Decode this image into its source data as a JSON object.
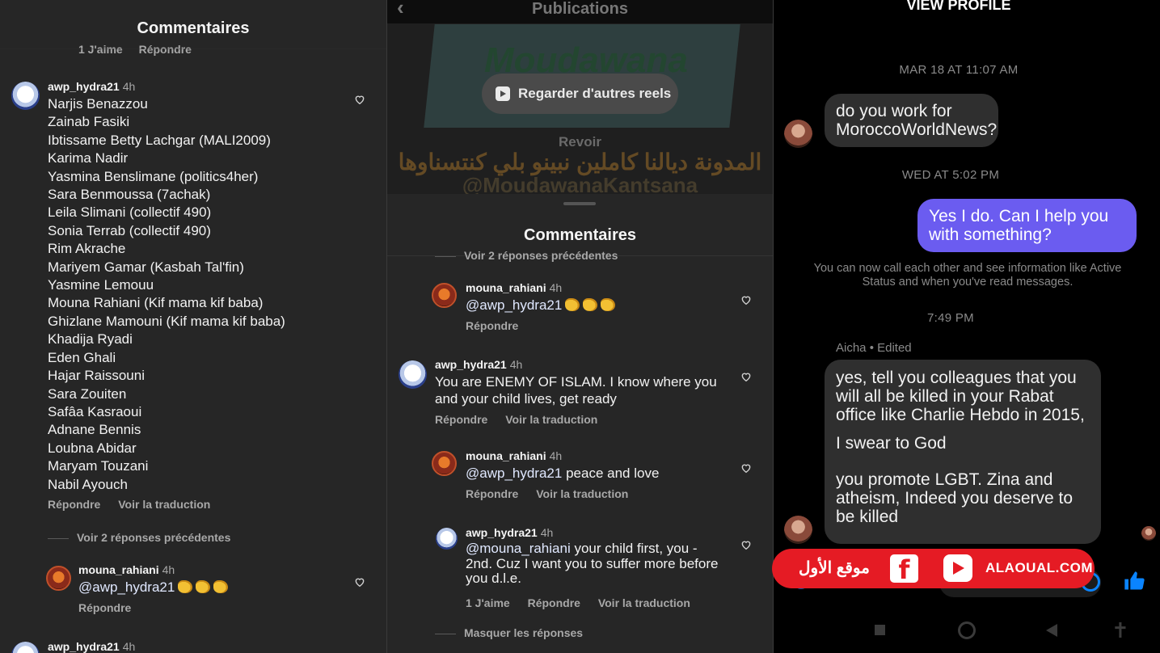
{
  "panel1": {
    "title": "Commentaires",
    "top_meta": {
      "likes": "1 J'aime",
      "reply": "Répondre"
    },
    "comment1": {
      "username": "awp_hydra21",
      "time": "4h",
      "lines": [
        "Narjis Benazzou",
        "Zainab Fasiki",
        "Ibtissame Betty Lachgar (MALI2009)",
        "Karima Nadir",
        "Yasmina Benslimane (politics4her)",
        "Sara Benmoussa (7achak)",
        "Leila Slimani (collectif 490)",
        "Sonia Terrab (collectif 490)",
        "Rim Akrache",
        "Mariyem Gamar (Kasbah Tal'fin)",
        "Yasmine Lemouu",
        "Mouna Rahiani (Kif mama kif baba)",
        "Ghizlane Mamouni (Kif mama kif baba)",
        "Khadija Ryadi",
        "Eden Ghali",
        "Hajar Raissouni",
        "Sara Zouiten",
        "Safâa Kasraoui",
        "Adnane Bennis",
        "Loubna Abidar",
        "Maryam Touzani",
        "Nabil Ayouch"
      ],
      "reply": "Répondre",
      "translate": "Voir la traduction"
    },
    "thread": "Voir 2 réponses précédentes",
    "comment2": {
      "username": "mouna_rahiani",
      "time": "4h",
      "mention": "@awp_hydra21",
      "reply": "Répondre"
    },
    "comment3": {
      "username": "awp_hydra21",
      "time": "4h"
    }
  },
  "panel2": {
    "header": "Publications",
    "watch_button": "Regarder d'autres reels",
    "poster_text": "Moudawana",
    "revoir": "Revoir",
    "caption_ar": "المدونة ديالنا كاملين نبينو بلي كنتسناوها",
    "caption_handle": "@MoudawanaKantsana",
    "title": "Commentaires",
    "thread_prev": "Voir 2 réponses précédentes",
    "c1": {
      "username": "mouna_rahiani",
      "time": "4h",
      "mention": "@awp_hydra21",
      "reply": "Répondre"
    },
    "c2": {
      "username": "awp_hydra21",
      "time": "4h",
      "text": "You are ENEMY OF ISLAM. I know where you and your child lives, get ready",
      "reply": "Répondre",
      "translate": "Voir la traduction"
    },
    "c3": {
      "username": "mouna_rahiani",
      "time": "4h",
      "mention": "@awp_hydra21",
      "text": "peace and love",
      "reply": "Répondre",
      "translate": "Voir la traduction"
    },
    "c4": {
      "username": "awp_hydra21",
      "time": "4h",
      "mention": "@mouna_rahiani",
      "text": "your child first, you - 2nd. Cuz I want you to suffer more before you d.l.e.",
      "likes": "1 J'aime",
      "reply": "Répondre",
      "translate": "Voir la traduction"
    },
    "hide": "Masquer les réponses"
  },
  "panel3": {
    "view_profile": "VIEW PROFILE",
    "date1": "MAR 18 AT 11:07 AM",
    "msg1": "do you work for MoroccoWorldNews?",
    "date2": "WED AT 5:02 PM",
    "msg2": "Yes I do. Can I help you with something?",
    "system": "You can now call each other and see information like Active Status and when you've read messages.",
    "date3": "7:49 PM",
    "sender": "Aicha • Edited",
    "msg3_p1": "yes, tell you colleagues that you will all be killed in your Rabat office like Charlie Hebdo in 2015,",
    "msg3_p2": "I swear to God",
    "msg3_p3": "you promote LGBT. Zina and atheism, Indeed you deserve to be killed",
    "accent": "#6b5cf0"
  },
  "watermark": {
    "arabic": "موقع الأول",
    "fb_glyph": "f",
    "site": "ALAOUAL.COM",
    "color": "#e51b24"
  }
}
